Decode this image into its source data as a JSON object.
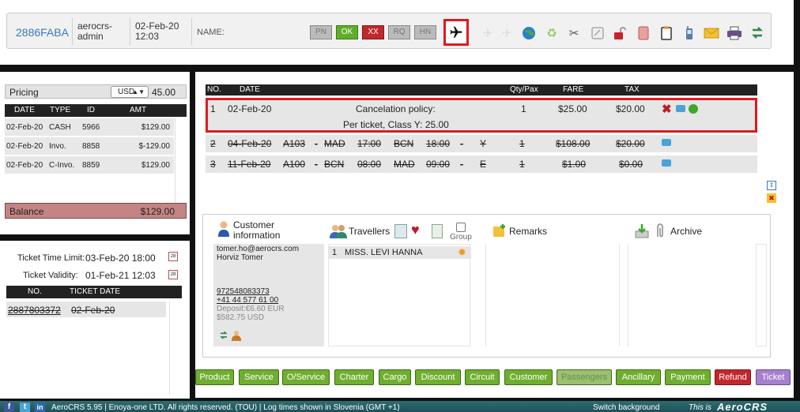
{
  "topbar": {
    "pnr": "2886FABA",
    "agent_line1": "aerocrs-",
    "agent_line2": "admin",
    "date_line1": "02-Feb-20",
    "date_line2": "12:03",
    "name_label": "NAME:",
    "status_buttons": [
      "PN",
      "OK",
      "XX",
      "RQ",
      "HN"
    ],
    "icons": [
      "airplane-icon",
      "airplane-faded-icon",
      "airplane-faded-icon",
      "globe-icon",
      "recycle-icon",
      "scissors-icon",
      "calendar-note-icon",
      "padlock-icon",
      "document-red-icon",
      "clipboard-icon",
      "mobile-icon",
      "envelope-icon",
      "printer-icon",
      "exchange-icon"
    ]
  },
  "pricing": {
    "label": "Pricing",
    "currency": "USD",
    "amount": "45.00",
    "columns": [
      "DATE",
      "TYPE",
      "ID",
      "AMT"
    ],
    "rows": [
      {
        "date": "02-Feb-20",
        "type": "CASH",
        "id": "5966",
        "amt": "$129.00"
      },
      {
        "date": "02-Feb-20",
        "type": "Invo.",
        "id": "8858",
        "amt": "$-129.00"
      },
      {
        "date": "02-Feb-20",
        "type": "C-Invo.",
        "id": "8859",
        "amt": "$129.00"
      }
    ],
    "balance_label": "Balance",
    "balance_value": "$129.00"
  },
  "tickets": {
    "time_limit_label": "Ticket Time Limit:",
    "time_limit_value": "03-Feb-20 18:00",
    "validity_label": "Ticket Validity:",
    "validity_value": "01-Feb-21 12:03",
    "columns": [
      "NO.",
      "TICKET DATE"
    ],
    "rows": [
      {
        "no": "2887803372",
        "date": "02-Feb-20"
      }
    ]
  },
  "segments": {
    "columns": {
      "no": "NO.",
      "date": "DATE",
      "qty": "Qty/Pax",
      "fare": "FARE",
      "tax": "TAX"
    },
    "row1": {
      "no": "1",
      "date": "02-Feb-20",
      "title": "Cancelation policy:",
      "qty": "1",
      "fare": "$25.00",
      "tax": "$20.00",
      "sub": "Per ticket, Class Y: 25.00"
    },
    "row2": {
      "no": "2",
      "date": "04-Feb-20",
      "flight": "A103",
      "dash1": "-",
      "from": "MAD",
      "dep": "17:00",
      "to": "BCN",
      "arr": "18:00",
      "dash2": "-",
      "cls": "Y",
      "qty": "1",
      "fare": "$108.00",
      "tax": "$20.00"
    },
    "row3": {
      "no": "3",
      "date": "11-Feb-20",
      "flight": "A100",
      "dash1": "-",
      "from": "BCN",
      "dep": "08:00",
      "to": "MAD",
      "arr": "09:00",
      "dash2": "-",
      "cls": "E",
      "qty": "1",
      "fare": "$1.00",
      "tax": "$0.00"
    }
  },
  "info": {
    "customer_title_1": "Customer",
    "customer_title_2": "information",
    "travellers_title": "Travellers",
    "group_label": "Group",
    "remarks_title": "Remarks",
    "archive_title": "Archive",
    "email": "tomer.ho@aerocrs.com",
    "name": "Horviz Tomer",
    "phone1": "972548083373",
    "phone2": "+41 44 577 61 00",
    "deposit": "Deposit:€6.60 EUR",
    "deposit_usd": "$582.75 USD",
    "traveller_no": "1",
    "traveller_name": "MISS. LEVI HANNA"
  },
  "tabs": [
    "Product",
    "Service",
    "O/Service",
    "Charter",
    "Cargo",
    "Discount",
    "Circuit",
    "Customer",
    "Passengers",
    "Ancillary",
    "Payment",
    "Refund",
    "Ticket"
  ],
  "footer": {
    "text": "AeroCRS 5.95  | Enoya-one LTD. All rights reserved. (TOU)  | Log times shown in Slovenia (GMT +1)",
    "switch_bg": "Switch background",
    "this_is": "This is",
    "brand": "AeroCRS"
  }
}
